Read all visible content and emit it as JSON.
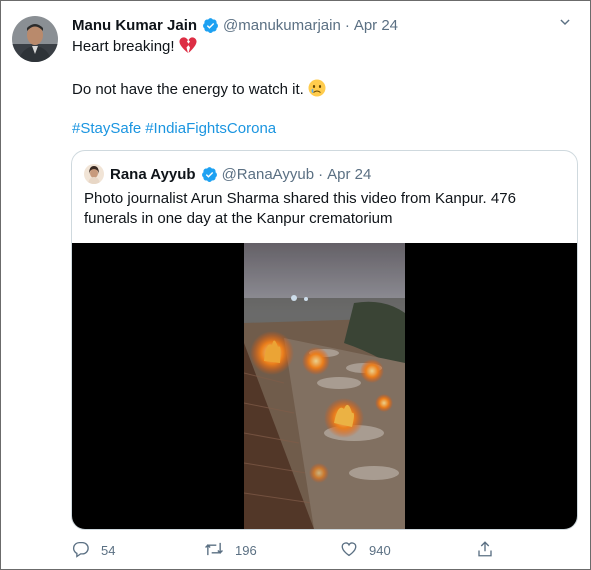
{
  "tweet": {
    "author_name": "Manu Kumar Jain",
    "author_handle": "@manukumarjain",
    "separator": "·",
    "date": "Apr 24",
    "lines": [
      "Heart breaking!",
      "Do not have the energy to watch it."
    ],
    "hashtags": [
      "#StaySafe",
      "#IndiaFightsCorona"
    ],
    "emojis": [
      "broken-heart-emoji",
      "crying-face-emoji"
    ]
  },
  "quoted_tweet": {
    "author_name": "Rana Ayyub",
    "author_handle": "@RanaAyyub",
    "separator": "·",
    "date": "Apr 24",
    "text": "Photo journalist Arun Sharma shared this video from Kanpur. 476 funerals in one day at the Kanpur crematorium"
  },
  "actions": {
    "replies": "54",
    "retweets": "196",
    "likes": "940"
  },
  "colors": {
    "link": "#1b95e0",
    "verified": "#1da1f2",
    "muted": "#5b7083"
  }
}
